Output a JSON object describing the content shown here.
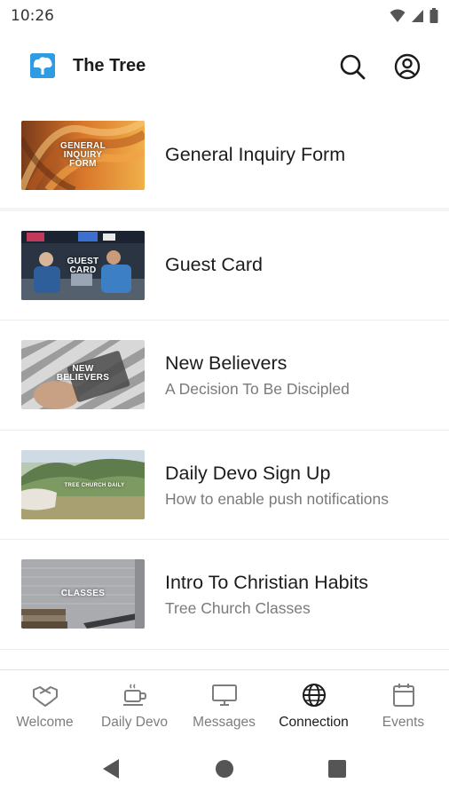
{
  "status_bar": {
    "time": "10:26"
  },
  "app_bar": {
    "title": "The Tree"
  },
  "items": [
    {
      "title": "General Inquiry Form",
      "subtitle": "",
      "thumb_label": "GENERAL INQUIRY FORM"
    },
    {
      "title": "Guest Card",
      "subtitle": "",
      "thumb_label": "GUEST CARD"
    },
    {
      "title": "New Believers",
      "subtitle": "A Decision To Be Discipled",
      "thumb_label": "NEW BELIEVERS"
    },
    {
      "title": "Daily Devo Sign Up",
      "subtitle": "How to enable push notifications",
      "thumb_label": "TREE CHURCH DAILY"
    },
    {
      "title": "Intro To Christian Habits",
      "subtitle": "Tree Church Classes",
      "thumb_label": "CLASSES"
    }
  ],
  "bottom_nav": {
    "tabs": [
      {
        "label": "Welcome",
        "icon": "handshake-icon"
      },
      {
        "label": "Daily Devo",
        "icon": "coffee-cup-icon"
      },
      {
        "label": "Messages",
        "icon": "monitor-icon"
      },
      {
        "label": "Connection",
        "icon": "globe-icon",
        "active": true
      },
      {
        "label": "Events",
        "icon": "calendar-icon"
      }
    ]
  },
  "colors": {
    "accent": "#2f9be0",
    "text": "#1c1c1c",
    "muted": "#7a7a7a"
  }
}
